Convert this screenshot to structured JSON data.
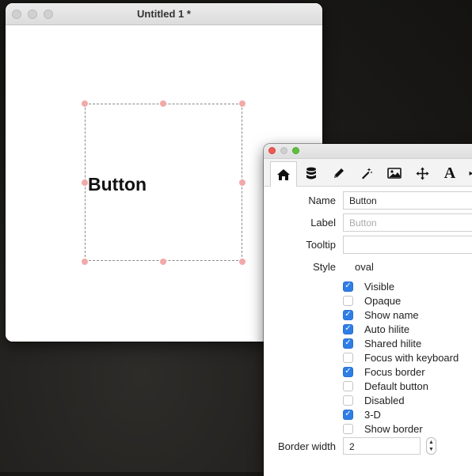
{
  "card_window": {
    "title": "Untitled 1 *",
    "button_name": "Button"
  },
  "inspector": {
    "toolbar_icons": [
      "home-icon",
      "database-icon",
      "pencil-icon",
      "magic-wand-icon",
      "image-icon",
      "move-icon",
      "text-icon"
    ],
    "fields": {
      "name_label": "Name",
      "name_value": "Button",
      "label_label": "Label",
      "label_placeholder": "Button",
      "tooltip_label": "Tooltip",
      "tooltip_value": "",
      "style_label": "Style",
      "style_value": "oval"
    },
    "checkboxes": [
      {
        "label": "Visible",
        "checked": true
      },
      {
        "label": "Opaque",
        "checked": false
      },
      {
        "label": "Show name",
        "checked": true
      },
      {
        "label": "Auto hilite",
        "checked": true
      },
      {
        "label": "Shared hilite",
        "checked": true
      },
      {
        "label": "Focus with keyboard",
        "checked": false
      },
      {
        "label": "Focus border",
        "checked": true
      },
      {
        "label": "Default button",
        "checked": false
      },
      {
        "label": "Disabled",
        "checked": false
      },
      {
        "label": "3-D",
        "checked": true
      },
      {
        "label": "Show border",
        "checked": false
      }
    ],
    "border_width_label": "Border width",
    "border_width_value": "2",
    "colors": {
      "accent": "#2f7ee6",
      "close": "#ee5a52",
      "minimize": "#f5bd2f",
      "zoom": "#5fc13b"
    }
  }
}
